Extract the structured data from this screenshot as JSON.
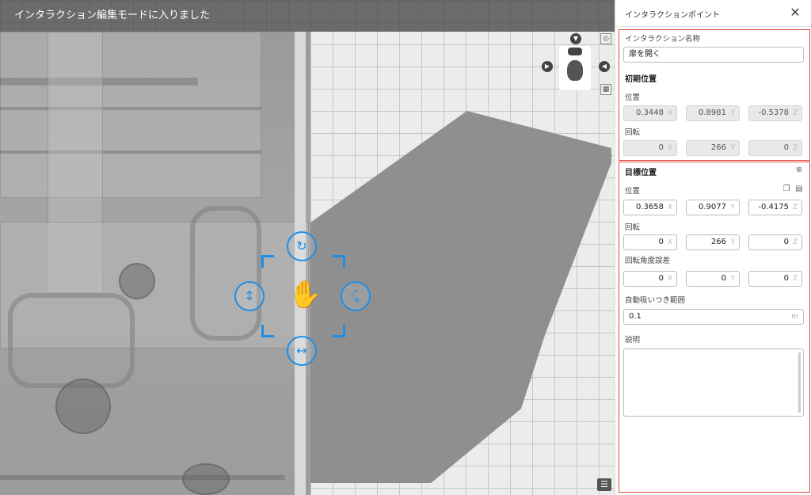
{
  "viewport": {
    "banner": "インタラクション編集モードに入りました",
    "icons": {
      "nav_down": "chevron-down-icon",
      "nav_left": "chevron-left-icon",
      "nav_right": "chevron-right-icon",
      "camera": "camera-target-icon",
      "grid": "grid-icon",
      "list": "list-icon"
    }
  },
  "panel": {
    "title": "インタラクションポイント",
    "name_label": "インタラクション名称",
    "name_value": "扉を開く",
    "initial": {
      "heading": "初期位置",
      "position_label": "位置",
      "position": {
        "x": "0.3448",
        "y": "0.8981",
        "z": "-0.5378"
      },
      "rotation_label": "回転",
      "rotation": {
        "x": "0",
        "y": "266",
        "z": "0"
      }
    },
    "target": {
      "heading": "目標位置",
      "position_label": "位置",
      "position": {
        "x": "0.3658",
        "y": "0.9077",
        "z": "-0.4175"
      },
      "rotation_label": "回転",
      "rotation": {
        "x": "0",
        "y": "266",
        "z": "0"
      },
      "tolerance_label": "回転角度誤差",
      "tolerance": {
        "x": "0",
        "y": "0",
        "z": "0"
      }
    },
    "snap_label": "自動吸いつき範囲",
    "snap_value": "0.1",
    "snap_unit": "m",
    "desc_label": "説明",
    "axes": {
      "x": "X",
      "y": "Y",
      "z": "Z"
    }
  },
  "colors": {
    "accent": "#1d8fe6",
    "highlight": "#e0473a"
  }
}
